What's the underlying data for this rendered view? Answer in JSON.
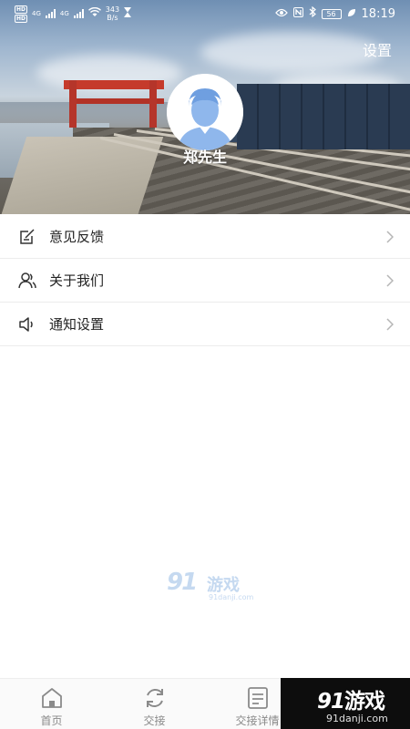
{
  "status_bar": {
    "hd1": "HD",
    "hd2": "HD",
    "net1": "4G",
    "net2": "4G",
    "speed_value": "343",
    "speed_unit": "B/s",
    "battery": "56",
    "time": "18:19"
  },
  "header": {
    "settings_label": "设置",
    "user_name": "郑先生"
  },
  "menu": {
    "items": [
      {
        "label": "意见反馈",
        "icon": "feedback-icon"
      },
      {
        "label": "关于我们",
        "icon": "users-icon"
      },
      {
        "label": "通知设置",
        "icon": "speaker-icon"
      }
    ]
  },
  "tabbar": {
    "tabs": [
      {
        "label": "首页",
        "icon": "home-icon"
      },
      {
        "label": "交接",
        "icon": "sync-icon"
      },
      {
        "label": "交接详情",
        "icon": "document-icon"
      }
    ]
  },
  "watermark": {
    "logo_number": "91",
    "logo_text": "游戏",
    "domain": "91danji.com"
  },
  "colors": {
    "menu_text": "#222222",
    "tab_inactive": "#8a8a8a",
    "avatar_accent": "#8fb7ec"
  }
}
